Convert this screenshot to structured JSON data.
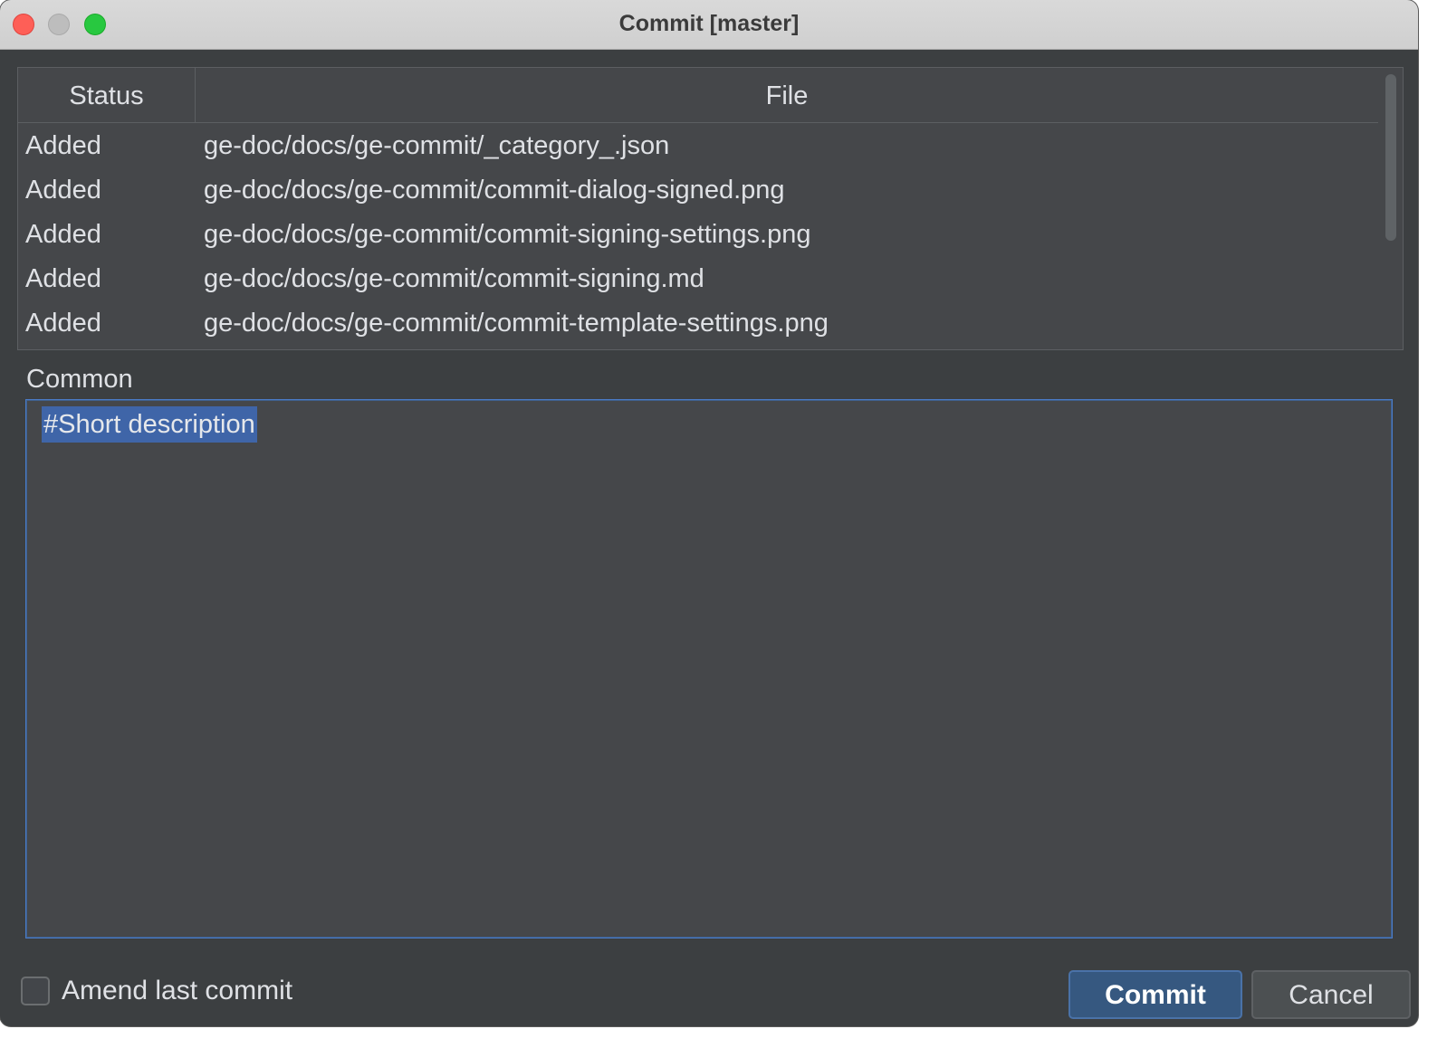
{
  "window": {
    "title": "Commit [master]"
  },
  "files_table": {
    "columns": [
      "Status",
      "File"
    ],
    "rows": [
      {
        "status": "Added",
        "file": "ge-doc/docs/ge-commit/_category_.json"
      },
      {
        "status": "Added",
        "file": "ge-doc/docs/ge-commit/commit-dialog-signed.png"
      },
      {
        "status": "Added",
        "file": "ge-doc/docs/ge-commit/commit-signing-settings.png"
      },
      {
        "status": "Added",
        "file": "ge-doc/docs/ge-commit/commit-signing.md"
      },
      {
        "status": "Added",
        "file": "ge-doc/docs/ge-commit/commit-template-settings.png"
      }
    ]
  },
  "message": {
    "label": "Common",
    "value": "#Short description"
  },
  "footer": {
    "amend_label": "Amend last commit",
    "amend_checked": false,
    "commit_label": "Commit",
    "cancel_label": "Cancel"
  },
  "colors": {
    "background": "#3c3f41",
    "panel": "#45474a",
    "accent": "#365880",
    "selection": "#3f65a8"
  }
}
